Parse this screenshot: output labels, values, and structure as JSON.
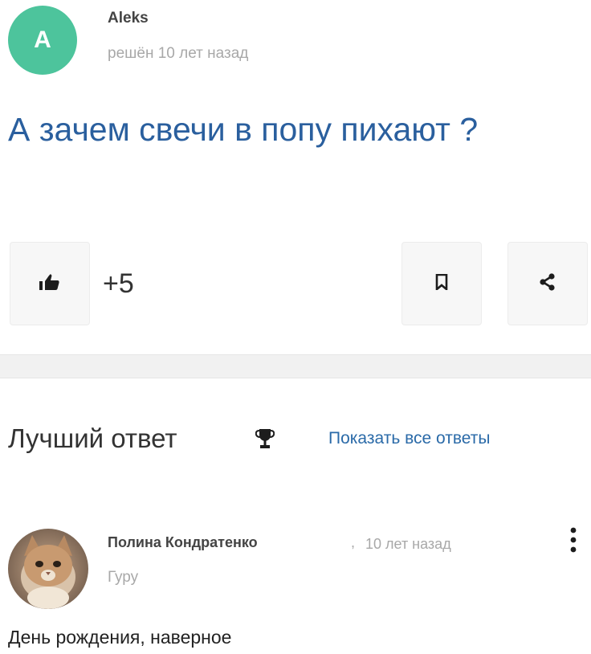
{
  "question": {
    "author": {
      "avatar_letter": "A",
      "name": "Aleks",
      "meta": "решён 10 лет назад"
    },
    "title": "А зачем свечи в попу пихают ?",
    "actions": {
      "like_icon": "thumbs-up-icon",
      "like_count": "+5",
      "bookmark_icon": "bookmark-icon",
      "share_icon": "share-icon"
    }
  },
  "answers_header": {
    "best_answer_label": "Лучший ответ",
    "trophy_icon": "trophy-icon",
    "show_all_label": "Показать все ответы"
  },
  "best_answer": {
    "author_name": "Полина Кондратенко",
    "separator": ",",
    "time": "10 лет назад",
    "rank": "Гуру",
    "text": "День рождения, наверное",
    "more_icon": "more-vertical-icon"
  },
  "colors": {
    "avatar_bg": "#4dc49c",
    "title_blue": "#2a5f9e",
    "link_blue": "#2a6aa8",
    "muted_gray": "#a8a8a8"
  }
}
